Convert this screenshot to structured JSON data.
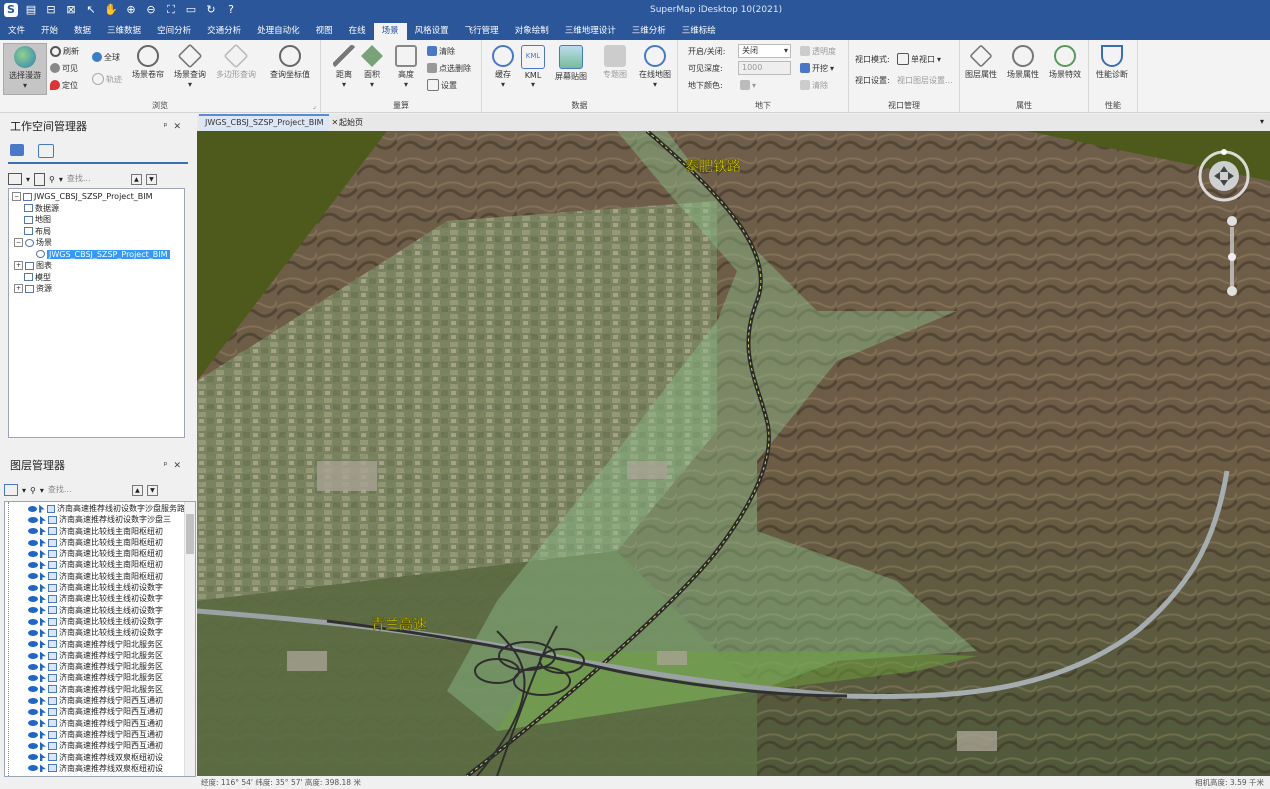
{
  "app_title": "SuperMap iDesktop 10(2021)",
  "menu_tabs": [
    "文件",
    "开始",
    "数据",
    "三维数据",
    "空间分析",
    "交通分析",
    "处理自动化",
    "视图",
    "在线",
    "场景",
    "风格设置",
    "飞行管理",
    "对象绘制",
    "三维地理设计",
    "三维分析",
    "三维标绘"
  ],
  "active_tab": "场景",
  "ribbon": {
    "browse": {
      "label": "浏览",
      "select_roam": "选择漫游",
      "refresh": "刷新",
      "visible": "可见",
      "locate": "定位",
      "full_globe": "全球",
      "track": "轨迹",
      "shutter": "场景卷帘",
      "scene_query": "场景查询",
      "polygon_query": "多边形查询",
      "coord_query": "查询坐标值"
    },
    "measure": {
      "label": "量算",
      "distance": "距离",
      "area": "面积",
      "height": "高度",
      "clear": "清除",
      "point_clear": "点选删除",
      "settings": "设置"
    },
    "data": {
      "label": "数据",
      "cache": "缓存",
      "kml": "KML",
      "screen_map": "屏幕贴图",
      "thematic": "专题图",
      "online_map": "在线地图"
    },
    "underground": {
      "label": "地下",
      "on_off_label": "开启/关闭:",
      "on_off_value": "关闭",
      "depth_label": "可见深度:",
      "depth_value": "1000",
      "color_label": "地下颜色:",
      "transparent": "透明度",
      "excavate": "开挖",
      "clear": "清除"
    },
    "viewport": {
      "label": "视口管理",
      "mode_label": "视口模式:",
      "mode_value": "单视口",
      "settings_label": "视口设置:",
      "settings_value": "视口图层设置..."
    },
    "props": {
      "label": "属性",
      "layer_props": "图层属性",
      "scene_props": "场景属性",
      "scene_effects": "场景特效"
    },
    "perf": {
      "label": "性能",
      "diagnose": "性能诊断"
    }
  },
  "workspace": {
    "title": "工作空间管理器",
    "search_placeholder": "查找...",
    "root": "JWGS_CBSJ_SZSP_Project_BIM",
    "datasources": "数据源",
    "maps": "地图",
    "layouts": "布局",
    "scenes": "场景",
    "scene_item": "JWGS_CBSJ_SZSP_Project_BIM",
    "symbols": "图表",
    "models": "模型",
    "resources": "资源"
  },
  "layers": {
    "title": "图层管理器",
    "search_placeholder": "查找...",
    "items": [
      "济南高速推荐线初设数字沙盘服务路",
      "济南高速推荐线初设数字沙盘三",
      "济南高速比较线主南阳枢纽初",
      "济南高速比较线主南阳枢纽初",
      "济南高速比较线主南阳枢纽初",
      "济南高速比较线主南阳枢纽初",
      "济南高速比较线主南阳枢纽初",
      "济南高速比较线主线初设数字",
      "济南高速比较线主线初设数字",
      "济南高速比较线主线初设数字",
      "济南高速比较线主线初设数字",
      "济南高速比较线主线初设数字",
      "济南高速推荐线宁阳北服务区",
      "济南高速推荐线宁阳北服务区",
      "济南高速推荐线宁阳北服务区",
      "济南高速推荐线宁阳北服务区",
      "济南高速推荐线宁阳北服务区",
      "济南高速推荐线宁阳西互通初",
      "济南高速推荐线宁阳西互通初",
      "济南高速推荐线宁阳西互通初",
      "济南高速推荐线宁阳西互通初",
      "济南高速推荐线宁阳西互通初",
      "济南高速推荐线双泉枢纽初设",
      "济南高速推荐线双泉枢纽初设"
    ]
  },
  "doc_tabs": [
    "JWGS_CBSJ_SZSP_Project_BIM",
    "起始页"
  ],
  "scene_labels": {
    "railway": "泰肥铁路",
    "highway": "青兰高速"
  },
  "status": {
    "left": "经度: 116° 54'   纬度: 35° 57'   高度: 398.18 米",
    "right": "相机高度: 3.59 千米"
  },
  "colors": {
    "accent": "#2b579a",
    "selection": "#3399ff",
    "label_yellow": "#f2e600",
    "sky_green": "#4d5a1c"
  }
}
